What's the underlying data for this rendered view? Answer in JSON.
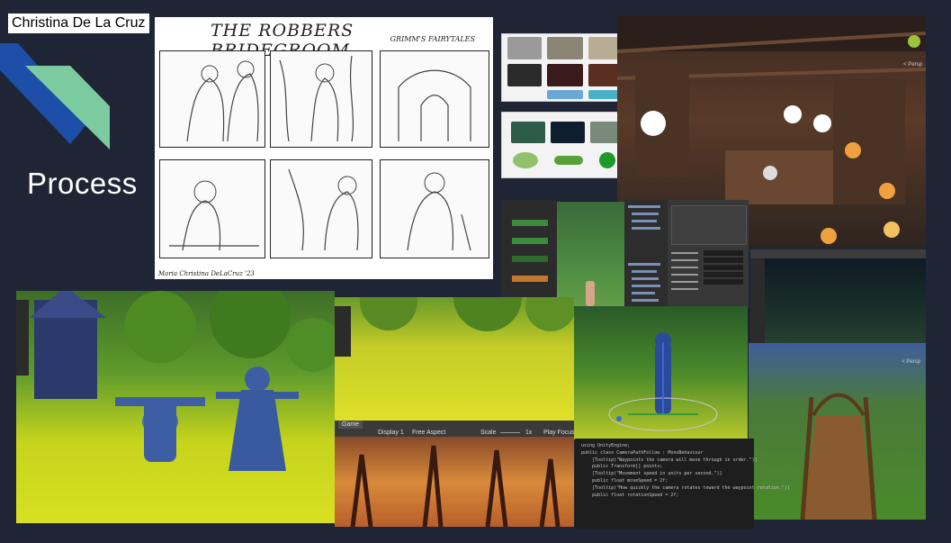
{
  "author": "Christina De La Cruz",
  "heading": "Process",
  "storyboard": {
    "title": "THE ROBBERS BRIDEGROOM",
    "subtitle": "GRIMM'S FAIRYTALES",
    "signature": "Maria Christina DeLaCruz '23"
  },
  "game_view": {
    "tab_label": "Game",
    "display": "Display 1",
    "aspect": "Free Aspect",
    "scale_label": "Scale",
    "scale_value": "1x",
    "play_focused": "Play Focuse"
  },
  "scene_labels": {
    "persp_top": "< Persp",
    "persp_bottom": "< Persp"
  },
  "code_lines": [
    "using UnityEngine;",
    "",
    "public class CameraPathFollow : MonoBehaviour",
    "",
    "    [Tooltip(\"Waypoints the camera will move through in order.\")]",
    "    public Transform[] points;",
    "",
    "    [Tooltip(\"Movement speed in units per second.\")]",
    "    public float moveSpeed = 2f;",
    "",
    "    [Tooltip(\"How quickly the camera rotates toward the waypoint rotation.\")]",
    "    public float rotationSpeed = 2f;"
  ],
  "colors": {
    "background": "#1f2534",
    "accent_blue": "#1d4fa8",
    "accent_mint": "#7ccaa0",
    "foliage": "#d8e021"
  }
}
